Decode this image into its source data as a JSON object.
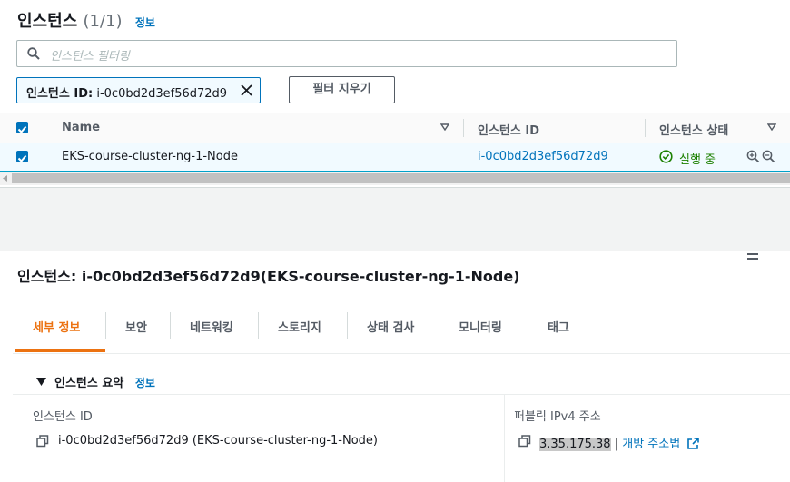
{
  "instances_panel": {
    "title": "인스턴스",
    "count": "(1/1)",
    "info_link": "정보",
    "search_placeholder": "인스턴스 필터링",
    "filter_token_key": "인스턴스 ID:",
    "filter_token_value": "i-0c0bd2d3ef56d72d9",
    "clear_filters_label": "필터 지우기"
  },
  "table": {
    "columns": [
      "Name",
      "인스턴스 ID",
      "인스턴스 상태"
    ],
    "rows": [
      {
        "name": "EKS-course-cluster-ng-1-Node",
        "instance_id": "i-0c0bd2d3ef56d72d9",
        "state": "실행 중",
        "state_color": "#1d8102"
      }
    ]
  },
  "details": {
    "title_prefix": "인스턴스:",
    "title_value": "i-0c0bd2d3ef56d72d9(EKS-course-cluster-ng-1-Node)",
    "tabs": [
      "세부 정보",
      "보안",
      "네트워킹",
      "스토리지",
      "상태 검사",
      "모니터링",
      "태그"
    ],
    "active_tab": "세부 정보",
    "summary_heading": "인스턴스 요약",
    "summary_info_link": "정보",
    "fields": {
      "instance_id_label": "인스턴스 ID",
      "instance_id_value": "i-0c0bd2d3ef56d72d9 (EKS-course-cluster-ng-1-Node)",
      "public_ipv4_label": "퍼블릭 IPv4 주소",
      "public_ipv4_value": "3.35.175.38",
      "separator": "|",
      "open_address_label": "개방 주소법"
    }
  },
  "colors": {
    "accent": "#0073bb",
    "active_tab": "#ec7211",
    "running": "#1d8102"
  }
}
